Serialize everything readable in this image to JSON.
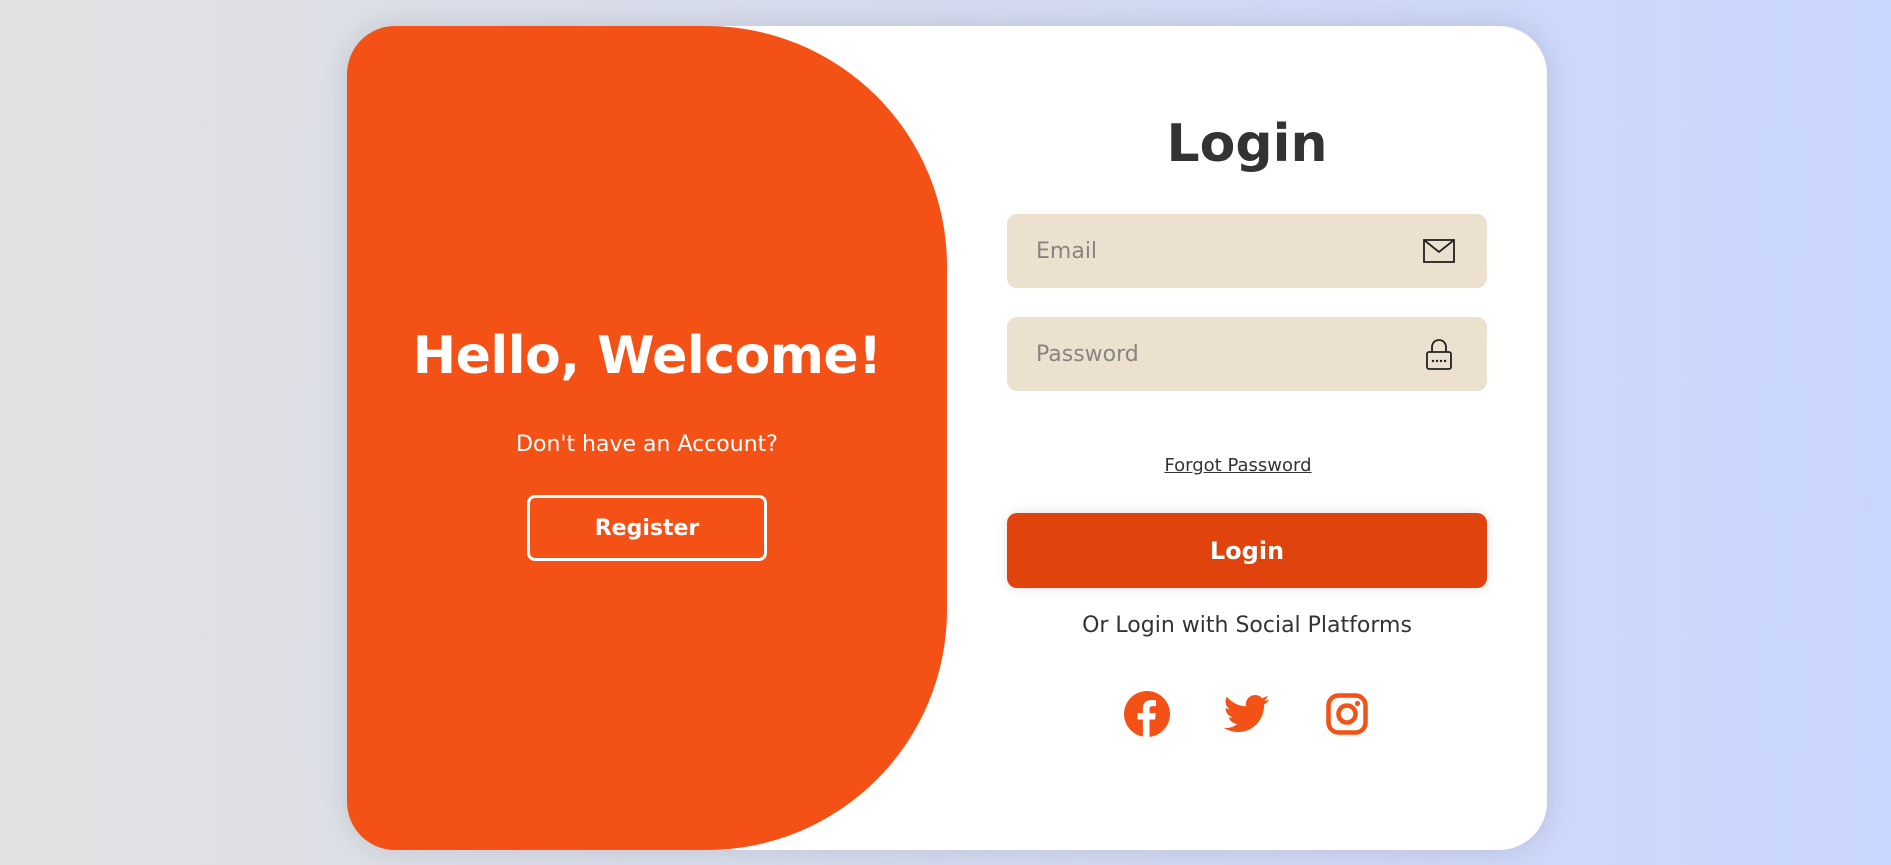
{
  "welcome": {
    "title": "Hello, Welcome!",
    "subtitle": "Don't have an Account?",
    "register_label": "Register"
  },
  "login_form": {
    "title": "Login",
    "email_placeholder": "Email",
    "password_placeholder": "Password",
    "forgot_label": "Forgot Password",
    "login_label": "Login",
    "social_text": "Or Login with Social Platforms"
  },
  "icons": {
    "email": "mail-icon",
    "password": "lock-icon",
    "social": [
      "facebook-icon",
      "twitter-icon",
      "instagram-icon"
    ]
  },
  "colors": {
    "accent": "#f45117",
    "login_button": "#e0440c",
    "field_background": "#ece0ce",
    "text": "#333333"
  }
}
